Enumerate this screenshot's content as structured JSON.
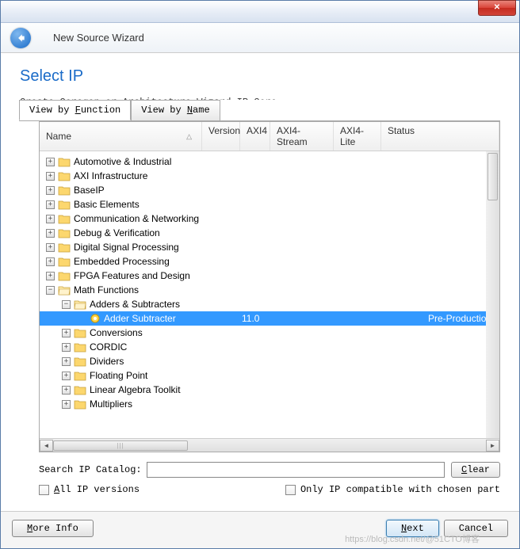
{
  "window": {
    "title": "New Source Wizard"
  },
  "page": {
    "title": "Select IP",
    "desc": "Create Coregen or Architecture Wizard IP Core."
  },
  "tabs": {
    "function": "View by Function",
    "function_ul": "F",
    "name": "View by Name",
    "name_ul": "N"
  },
  "columns": {
    "name": "Name",
    "version": "Version",
    "axi4": "AXI4",
    "axi4stream": "AXI4-Stream",
    "axi4lite": "AXI4-Lite",
    "status": "Status"
  },
  "tree": [
    {
      "label": "Automotive & Industrial",
      "depth": 0,
      "exp": "+",
      "type": "folder"
    },
    {
      "label": "AXI Infrastructure",
      "depth": 0,
      "exp": "+",
      "type": "folder"
    },
    {
      "label": "BaseIP",
      "depth": 0,
      "exp": "+",
      "type": "folder"
    },
    {
      "label": "Basic Elements",
      "depth": 0,
      "exp": "+",
      "type": "folder"
    },
    {
      "label": "Communication & Networking",
      "depth": 0,
      "exp": "+",
      "type": "folder"
    },
    {
      "label": "Debug & Verification",
      "depth": 0,
      "exp": "+",
      "type": "folder"
    },
    {
      "label": "Digital Signal Processing",
      "depth": 0,
      "exp": "+",
      "type": "folder"
    },
    {
      "label": "Embedded Processing",
      "depth": 0,
      "exp": "+",
      "type": "folder"
    },
    {
      "label": "FPGA Features and Design",
      "depth": 0,
      "exp": "+",
      "type": "folder"
    },
    {
      "label": "Math Functions",
      "depth": 0,
      "exp": "−",
      "type": "folder-open"
    },
    {
      "label": "Adders & Subtracters",
      "depth": 1,
      "exp": "−",
      "type": "folder-open"
    },
    {
      "label": "Adder Subtracter",
      "depth": 2,
      "exp": "",
      "type": "leaf",
      "selected": true,
      "version": "11.0",
      "status": "Pre-Production"
    },
    {
      "label": "Conversions",
      "depth": 1,
      "exp": "+",
      "type": "folder"
    },
    {
      "label": "CORDIC",
      "depth": 1,
      "exp": "+",
      "type": "folder"
    },
    {
      "label": "Dividers",
      "depth": 1,
      "exp": "+",
      "type": "folder"
    },
    {
      "label": "Floating Point",
      "depth": 1,
      "exp": "+",
      "type": "folder"
    },
    {
      "label": "Linear Algebra Toolkit",
      "depth": 1,
      "exp": "+",
      "type": "folder"
    },
    {
      "label": "Multipliers",
      "depth": 1,
      "exp": "+",
      "type": "folder"
    }
  ],
  "search": {
    "label": "Search IP Catalog:",
    "value": "",
    "clear": "Clear",
    "clear_ul": "C"
  },
  "checks": {
    "all_versions": "All IP versions",
    "all_ul": "A",
    "compat": "Only IP compatible with chosen part"
  },
  "buttons": {
    "more_info": "More Info",
    "more_ul": "M",
    "next": "Next",
    "next_ul": "N",
    "cancel": "Cancel"
  },
  "watermark": "https://blog.csdn.net/@51CTO博客"
}
